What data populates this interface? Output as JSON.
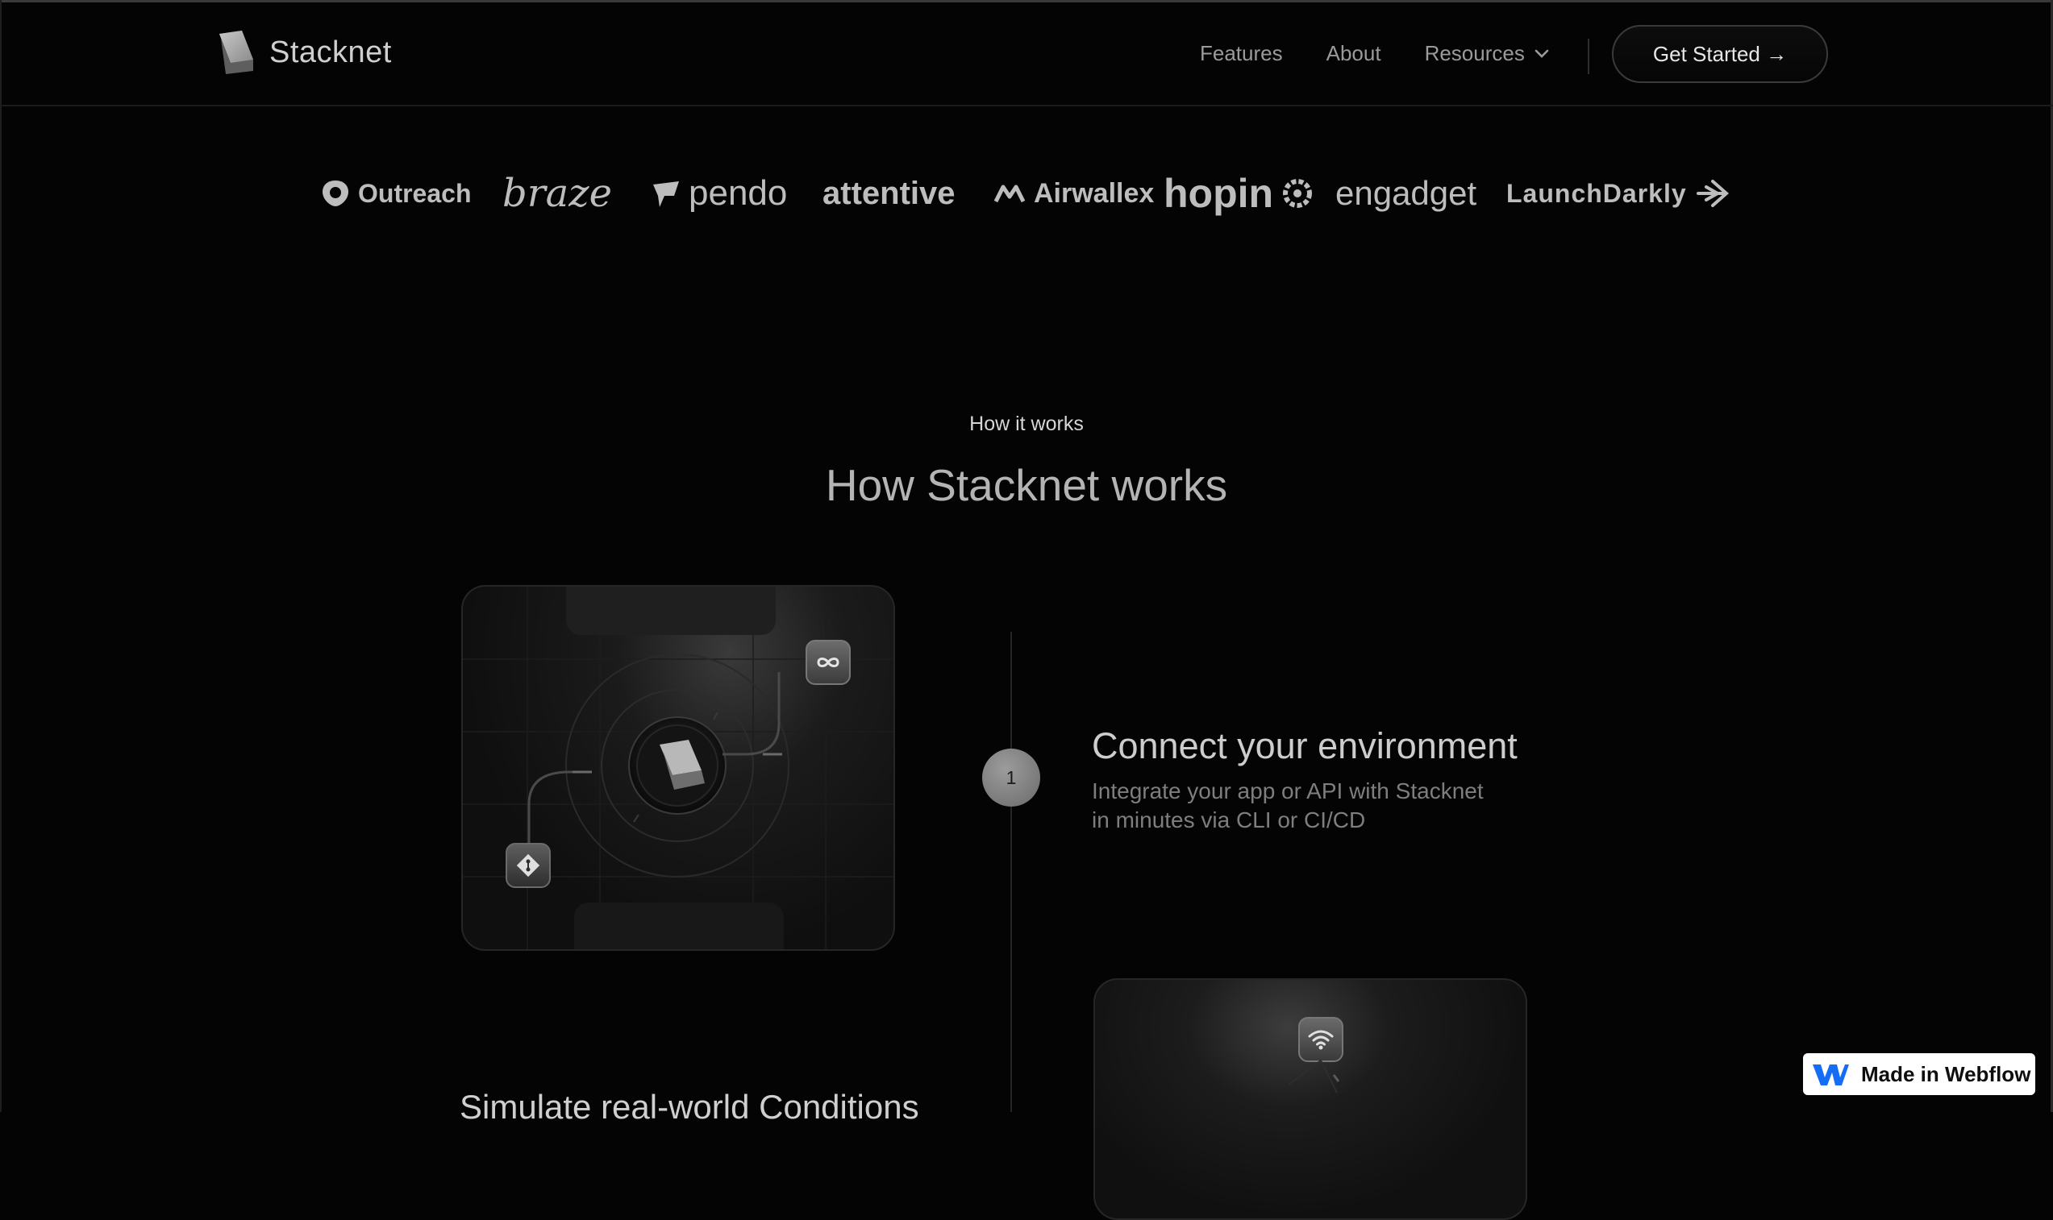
{
  "nav": {
    "brand": "Stacknet",
    "links": [
      "Features",
      "About",
      "Resources"
    ],
    "cta": "Get Started →"
  },
  "logos": [
    "Outreach",
    "braze",
    "pendo",
    "attentive",
    "Airwallex",
    "hopin",
    "engadget",
    "LaunchDarkly"
  ],
  "section": {
    "eyebrow": "How it works",
    "title": "How Stacknet works"
  },
  "steps": [
    {
      "number": "1",
      "title": "Connect your environment",
      "desc_line1": "Integrate your app or API with Stacknet",
      "desc_line2": "in minutes via CLI or CI/CD"
    }
  ],
  "next_step_title": "Simulate real-world Conditions",
  "badge": {
    "label": "Made in Webflow"
  },
  "icons": {
    "brand": "stacknet-logo-icon",
    "dropdown": "chevron-down-icon",
    "infinity": "infinity-icon",
    "git": "git-icon",
    "wifi": "wifi-icon",
    "webflow": "webflow-logo-icon"
  }
}
